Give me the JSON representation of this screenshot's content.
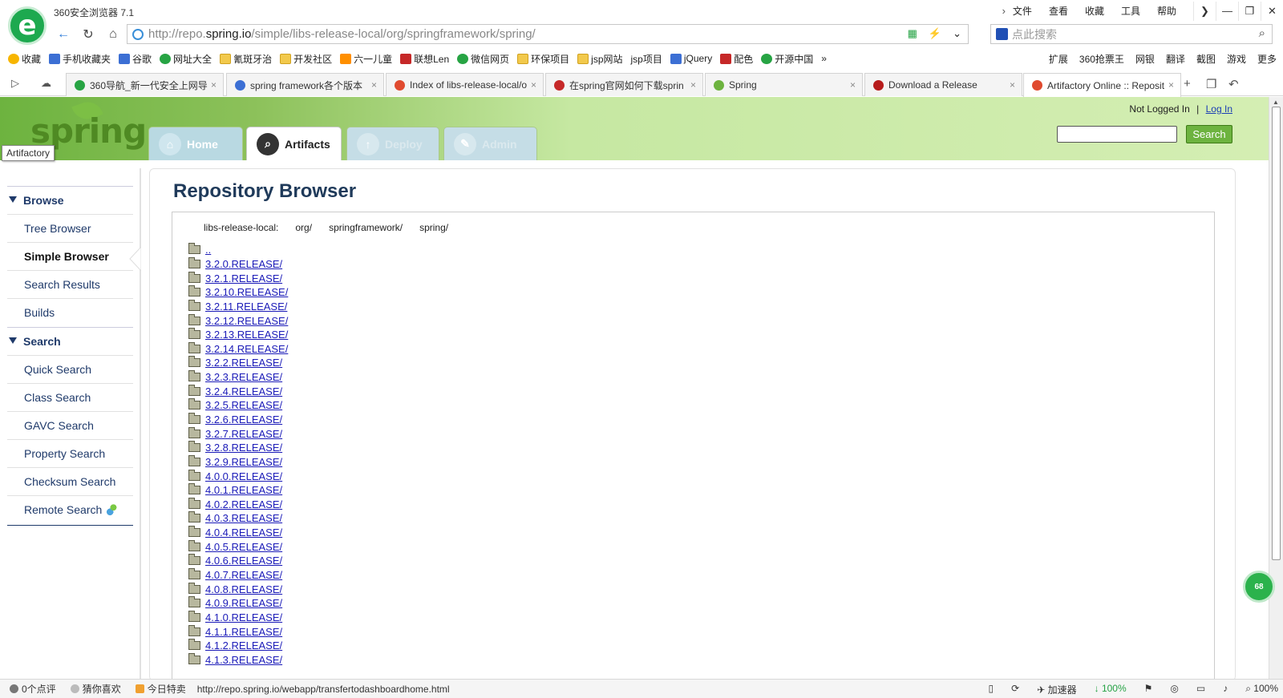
{
  "browser": {
    "title": "360安全浏览器 7.1",
    "menu": [
      "文件",
      "查看",
      "收藏",
      "工具",
      "帮助"
    ],
    "window_buttons": [
      "❯",
      "—",
      "❐",
      "✕"
    ],
    "url_prefix": "http://repo.",
    "url_host": "spring.io",
    "url_path": "/simple/libs-release-local/org/springframework/spring/",
    "search_placeholder": "点此搜索",
    "bookmarks": [
      {
        "label": "收藏",
        "icon": "star"
      },
      {
        "label": "手机收藏夹",
        "icon": "blue"
      },
      {
        "label": "谷歌",
        "icon": "blue"
      },
      {
        "label": "网址大全",
        "icon": "green"
      },
      {
        "label": "氰斑牙治",
        "icon": "folder"
      },
      {
        "label": "开发社区",
        "icon": "folder"
      },
      {
        "label": "六一儿童",
        "icon": "orange"
      },
      {
        "label": "联想Len",
        "icon": "red"
      },
      {
        "label": "微信网页",
        "icon": "green"
      },
      {
        "label": "环保项目",
        "icon": "folder"
      },
      {
        "label": "jsp网站",
        "icon": "folder"
      },
      {
        "label": "jsp项目",
        "icon": "page"
      },
      {
        "label": "jQuery",
        "icon": "blue"
      },
      {
        "label": "配色",
        "icon": "red"
      },
      {
        "label": "开源中国",
        "icon": "green"
      }
    ],
    "bookmarks_right": [
      "扩展",
      "360抢票王",
      "网银",
      "翻译",
      "截图",
      "游戏",
      "更多"
    ],
    "tabs": [
      {
        "label": "360导航_新一代安全上网导",
        "color": "#27a444"
      },
      {
        "label": "spring framework各个版本",
        "color": "#3c6fd4"
      },
      {
        "label": "Index of libs-release-local/o",
        "color": "#e04a2f"
      },
      {
        "label": "在spring官网如何下载sprin",
        "color": "#c62828"
      },
      {
        "label": "Spring",
        "color": "#6db33f"
      },
      {
        "label": "Download a Release",
        "color": "#b71c1c"
      },
      {
        "label": "Artifactory Online :: Reposit",
        "color": "#e04a2f"
      }
    ]
  },
  "header": {
    "logo": "spring",
    "tooltip": "Artifactory",
    "tabs": [
      "Home",
      "Artifacts",
      "Deploy",
      "Admin"
    ],
    "not_logged_in": "Not Logged In",
    "separator": "|",
    "login": "Log In",
    "search_button": "Search"
  },
  "sidebar": {
    "browse_header": "Browse",
    "browse_items": [
      "Tree Browser",
      "Simple Browser",
      "Search Results",
      "Builds"
    ],
    "search_header": "Search",
    "search_items": [
      "Quick Search",
      "Class Search",
      "GAVC Search",
      "Property Search",
      "Checksum Search",
      "Remote Search"
    ]
  },
  "main": {
    "title": "Repository Browser",
    "breadcrumb": [
      "libs-release-local:",
      "org/",
      "springframework/",
      "spring/"
    ],
    "entries": [
      "..",
      "3.2.0.RELEASE/",
      "3.2.1.RELEASE/",
      "3.2.10.RELEASE/",
      "3.2.11.RELEASE/",
      "3.2.12.RELEASE/",
      "3.2.13.RELEASE/",
      "3.2.14.RELEASE/",
      "3.2.2.RELEASE/",
      "3.2.3.RELEASE/",
      "3.2.4.RELEASE/",
      "3.2.5.RELEASE/",
      "3.2.6.RELEASE/",
      "3.2.7.RELEASE/",
      "3.2.8.RELEASE/",
      "3.2.9.RELEASE/",
      "4.0.0.RELEASE/",
      "4.0.1.RELEASE/",
      "4.0.2.RELEASE/",
      "4.0.3.RELEASE/",
      "4.0.4.RELEASE/",
      "4.0.5.RELEASE/",
      "4.0.6.RELEASE/",
      "4.0.7.RELEASE/",
      "4.0.8.RELEASE/",
      "4.0.9.RELEASE/",
      "4.1.0.RELEASE/",
      "4.1.1.RELEASE/",
      "4.1.2.RELEASE/",
      "4.1.3.RELEASE/"
    ]
  },
  "status": {
    "comments": "0个点评",
    "guess": "猜你喜欢",
    "deals": "今日特卖",
    "url": "http://repo.spring.io/webapp/transfertodashboardhome.html",
    "accelerator": "加速器",
    "download_pct": "100%",
    "zoom": "100%",
    "badge": "68"
  }
}
